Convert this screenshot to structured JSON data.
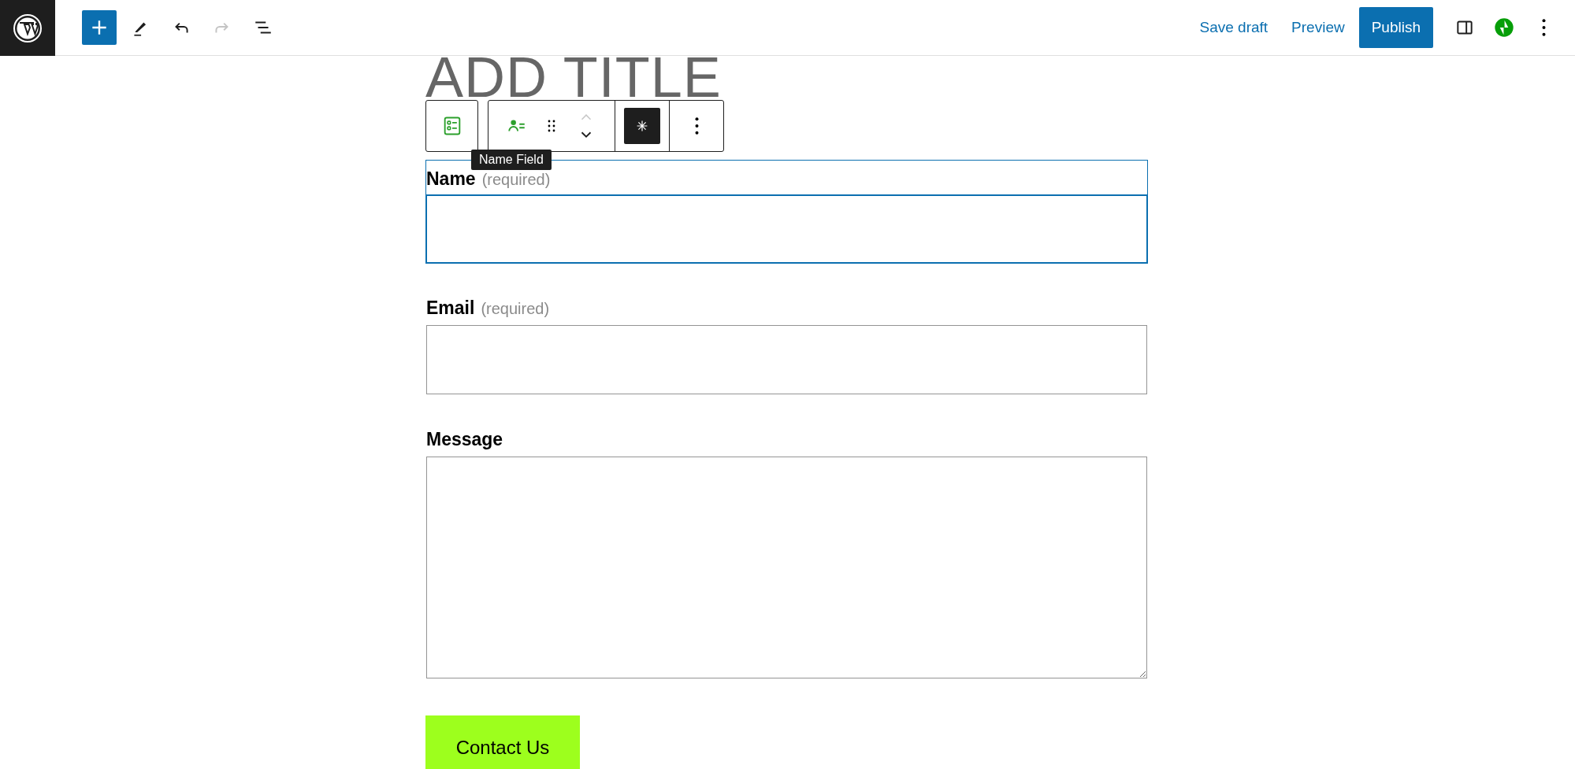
{
  "header": {
    "tools": [
      {
        "kind": "inserter",
        "disabled": false
      },
      {
        "kind": "edit",
        "disabled": false
      },
      {
        "kind": "undo",
        "disabled": false
      },
      {
        "kind": "redo",
        "disabled": true
      },
      {
        "kind": "outline",
        "disabled": false
      }
    ],
    "save_draft": "Save draft",
    "preview": "Preview",
    "publish": "Publish"
  },
  "title": {
    "placeholder": "ADD TITLE"
  },
  "block_toolbar": {
    "tooltip": "Name Field"
  },
  "form": {
    "fields": [
      {
        "kind": "input",
        "label": "Name",
        "note": "(required)",
        "selected": true
      },
      {
        "kind": "input",
        "label": "Email",
        "note": "(required)",
        "selected": false
      },
      {
        "kind": "textarea",
        "label": "Message",
        "selected": false
      }
    ],
    "submit": "Contact Us"
  }
}
